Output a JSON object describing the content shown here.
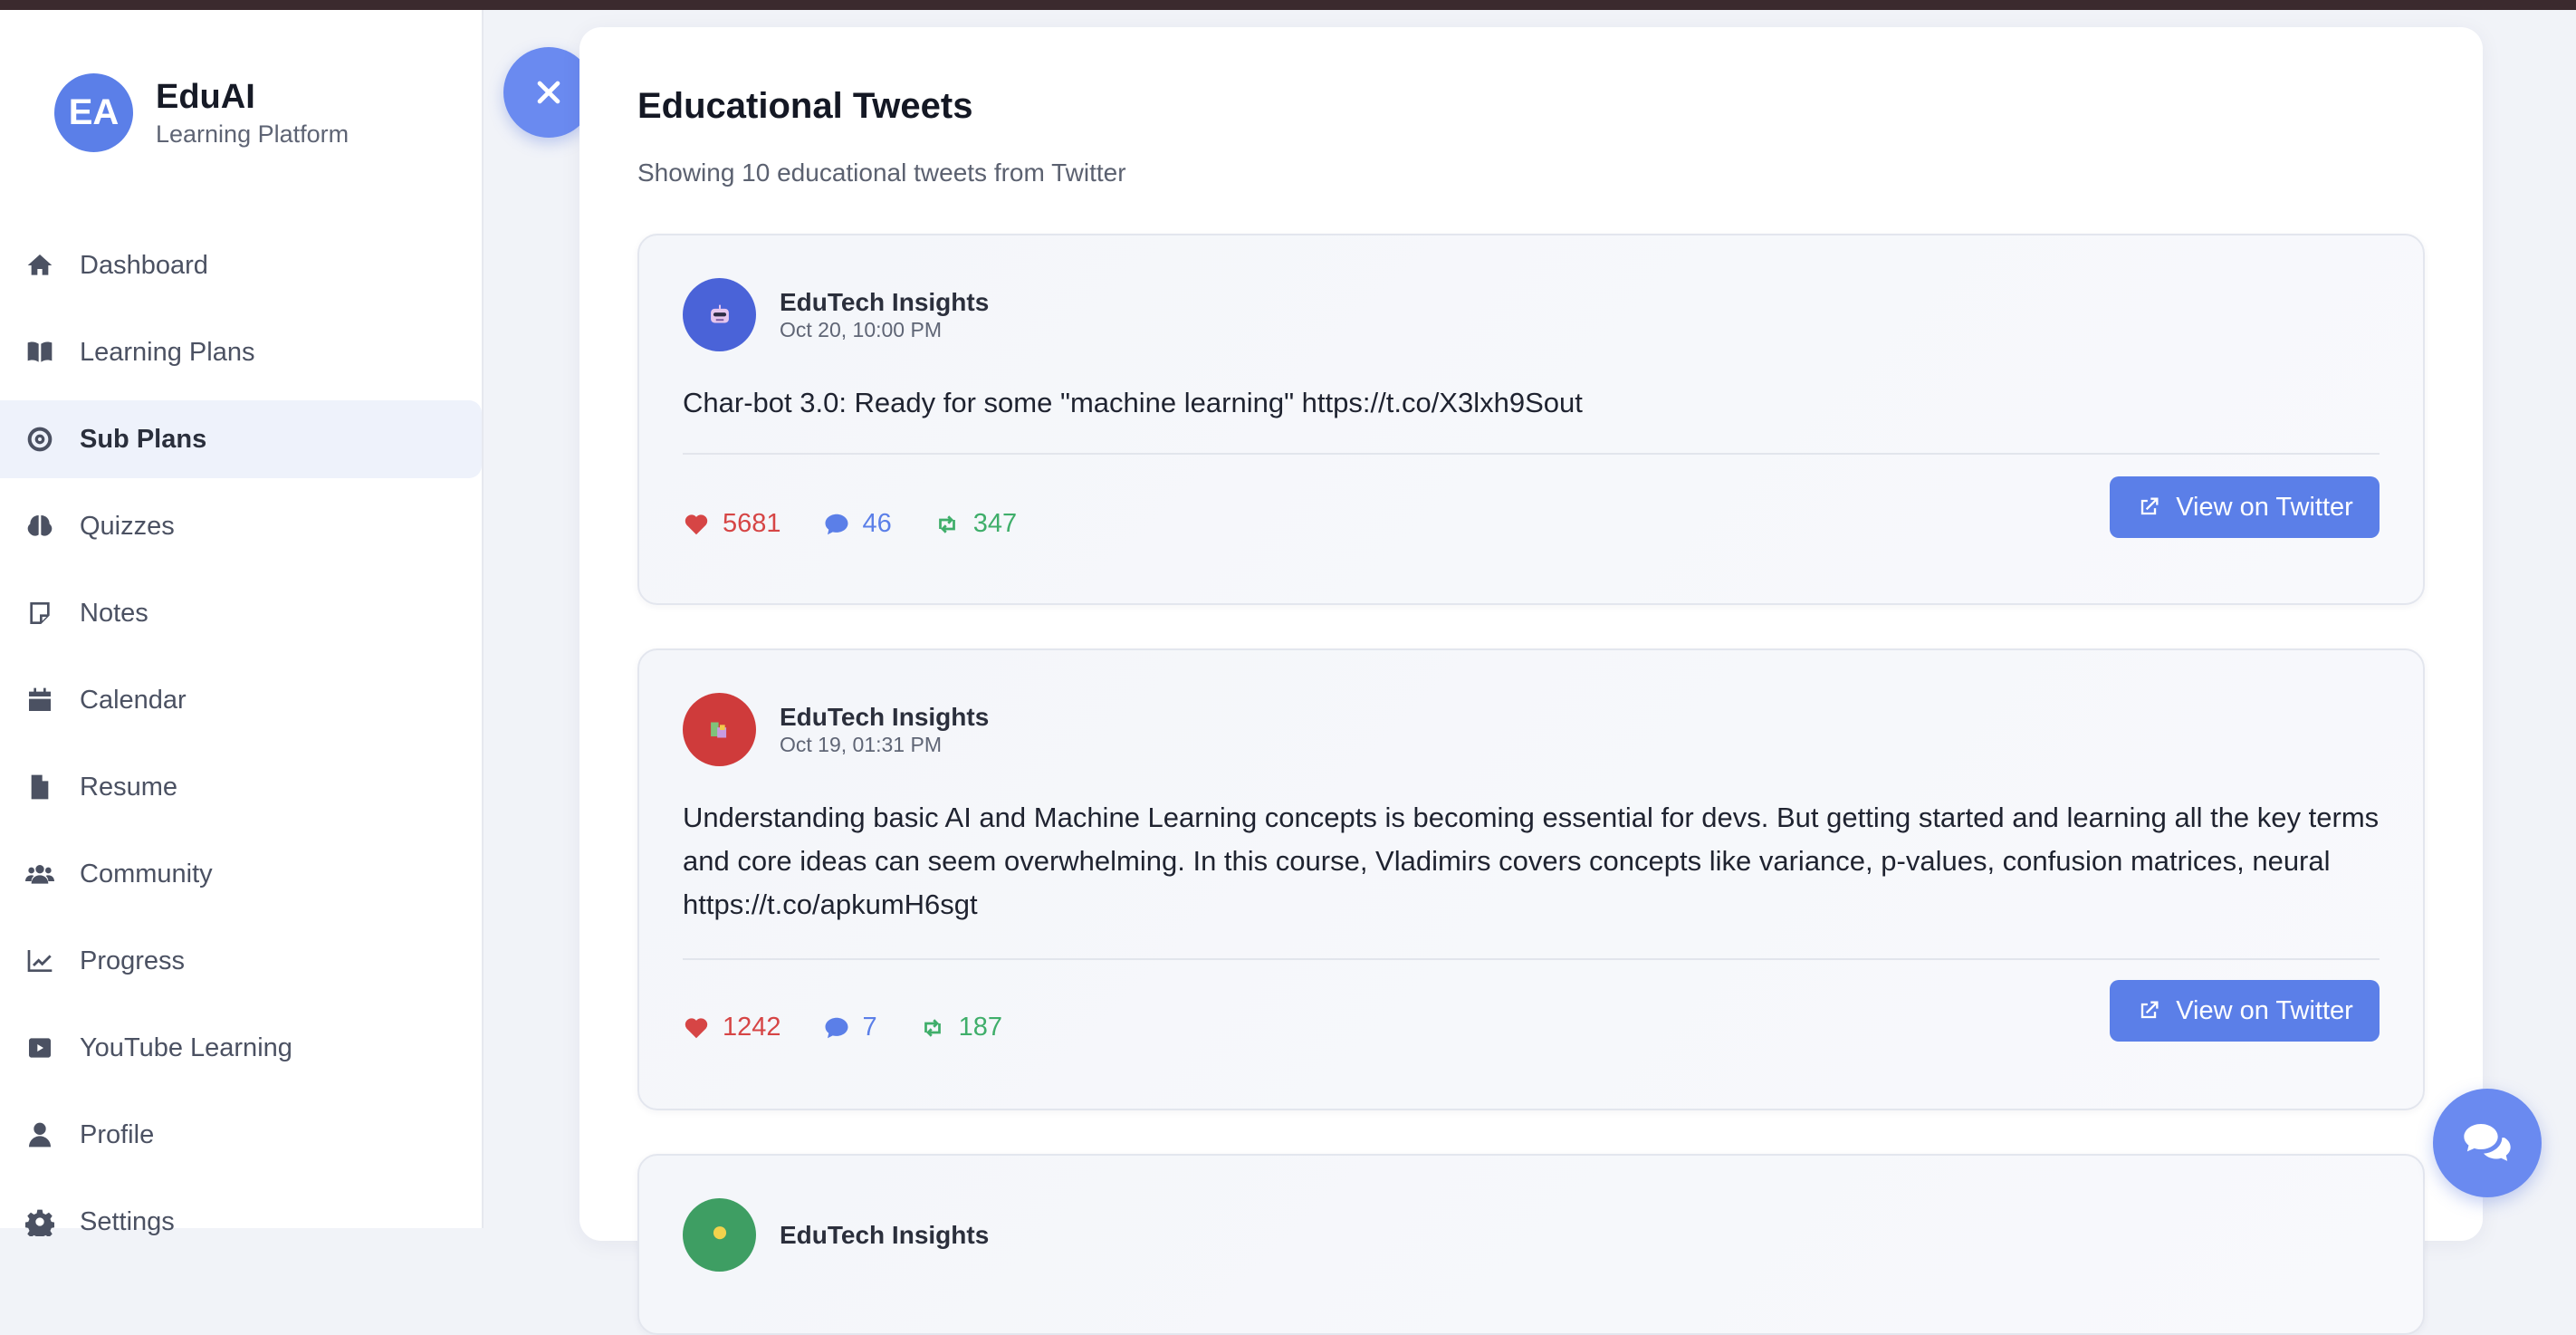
{
  "brand": {
    "initials": "EA",
    "name": "EduAI",
    "subtitle": "Learning Platform"
  },
  "nav": [
    {
      "label": "Dashboard",
      "icon": "home-icon"
    },
    {
      "label": "Learning Plans",
      "icon": "book-icon"
    },
    {
      "label": "Sub Plans",
      "icon": "target-icon",
      "active": true
    },
    {
      "label": "Quizzes",
      "icon": "brain-icon"
    },
    {
      "label": "Notes",
      "icon": "note-icon"
    },
    {
      "label": "Calendar",
      "icon": "calendar-icon"
    },
    {
      "label": "Resume",
      "icon": "file-icon"
    },
    {
      "label": "Community",
      "icon": "users-icon"
    },
    {
      "label": "Progress",
      "icon": "chart-line-icon"
    },
    {
      "label": "YouTube Learning",
      "icon": "youtube-icon"
    },
    {
      "label": "Profile",
      "icon": "user-icon"
    },
    {
      "label": "Settings",
      "icon": "gear-icon"
    }
  ],
  "panel": {
    "title": "Educational Tweets",
    "subtitle": "Showing 10 educational tweets from Twitter"
  },
  "tweets": [
    {
      "author": "EduTech Insights",
      "date": "Oct 20, 10:00 PM",
      "text": "Char-bot 3.0: Ready for some \"machine learning\" https://t.co/X3lxh9Sout",
      "likes": "5681",
      "comments": "46",
      "retweets": "347",
      "button": "View on Twitter",
      "avatar_color": "#4a63d8"
    },
    {
      "author": "EduTech Insights",
      "date": "Oct 19, 01:31 PM",
      "text": "Understanding basic AI and Machine Learning concepts is becoming essential for devs. But getting started and learning all the key terms and core ideas can seem overwhelming. In this course, Vladimirs covers concepts like variance, p-values, confusion matrices, neural https://t.co/apkumH6sgt",
      "likes": "1242",
      "comments": "7",
      "retweets": "187",
      "button": "View on Twitter",
      "avatar_color": "#cf3b3b"
    },
    {
      "author": "EduTech Insights",
      "avatar_color": "#3e9e63"
    }
  ],
  "colors": {
    "accent": "#5b7fe8",
    "likes": "#d64545",
    "comments": "#5b7fe8",
    "retweets": "#3fae6a"
  }
}
